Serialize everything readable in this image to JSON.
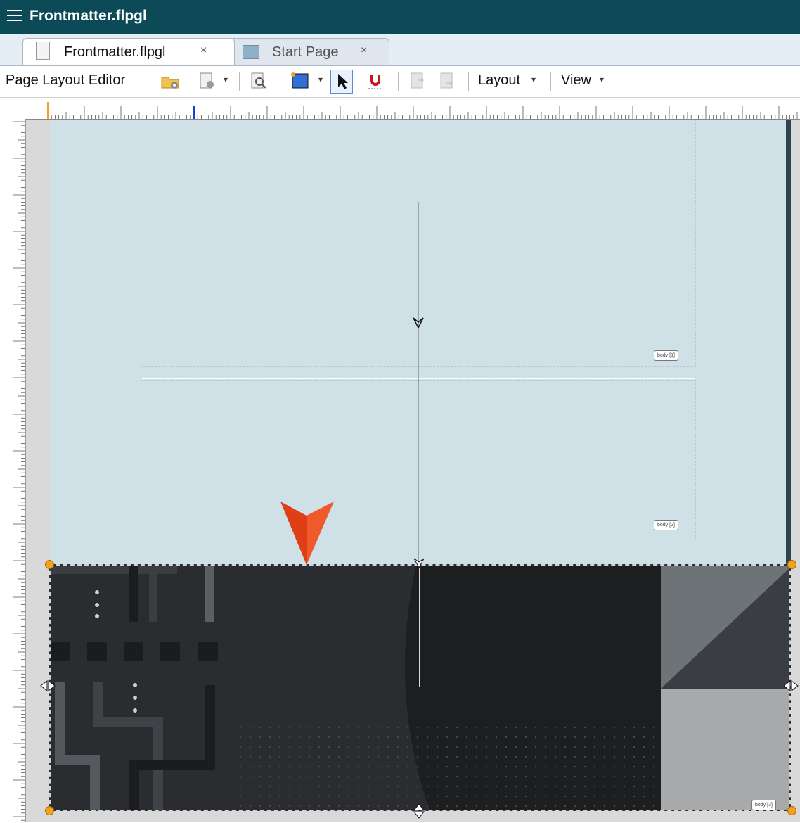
{
  "window": {
    "title": "Frontmatter.flpgl",
    "menu_icon": "hamburger-menu-icon"
  },
  "tabs": [
    {
      "label": "Frontmatter.flpgl",
      "close": "×",
      "icon": "document-icon",
      "active": true
    },
    {
      "label": "Start Page",
      "close": "×",
      "icon": "start-page-icon",
      "active": false
    }
  ],
  "toolbar": {
    "editor_label": "Page Layout Editor",
    "layout_label": "Layout",
    "view_label": "View",
    "caret": "▾",
    "icons": [
      "folder-gear-icon",
      "page-settings-icon",
      "preview-icon",
      "new-frame-icon",
      "select-pointer-icon",
      "magnet-snap-icon",
      "move-forward-icon",
      "move-backward-icon"
    ]
  },
  "frames": {
    "body1": "body [1]",
    "body2": "body [2]",
    "body3": "body [3]"
  },
  "colors": {
    "titlebar": "#0c4a58",
    "page_background": "#cfe0e7",
    "dark_frame": "#2a2c2f",
    "accent_arrow": "#e8491d",
    "handle": "#f0a21d"
  }
}
